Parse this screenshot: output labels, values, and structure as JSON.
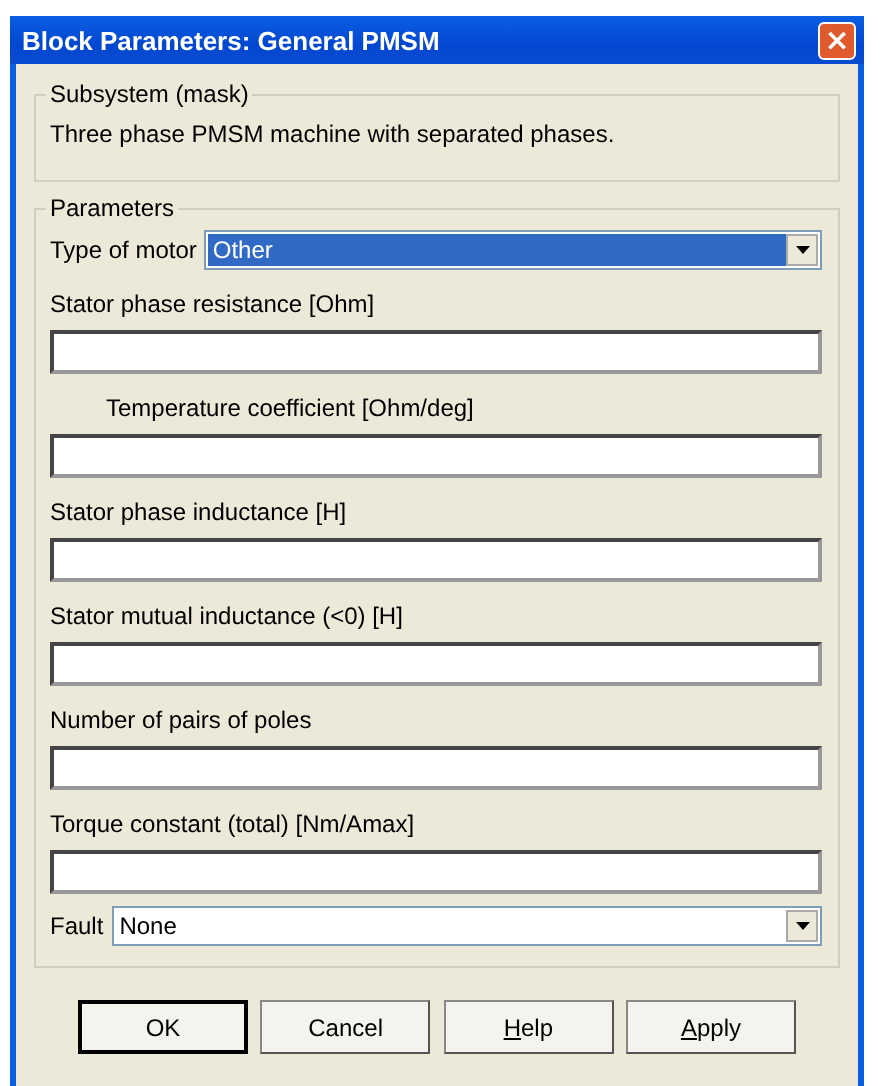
{
  "window": {
    "title": "Block Parameters: General PMSM",
    "close_glyph": "×"
  },
  "subsystem": {
    "legend": "Subsystem (mask)",
    "description": "Three phase PMSM machine with separated phases."
  },
  "parameters": {
    "legend": "Parameters",
    "motor_type": {
      "label": "Type of motor",
      "value": "Other",
      "focused": true
    },
    "fields": [
      {
        "label": "Stator phase resistance [Ohm]",
        "indented": false
      },
      {
        "label": "Temperature coefficient [Ohm/deg]",
        "indented": true
      },
      {
        "label": "Stator phase inductance [H]",
        "indented": false
      },
      {
        "label": "Stator mutual inductance (<0) [H]",
        "indented": false
      },
      {
        "label": "Number of pairs of poles",
        "indented": false
      },
      {
        "label": "Torque constant (total) [Nm/Amax]",
        "indented": false
      }
    ],
    "fault": {
      "label": "Fault",
      "value": "None",
      "focused": false
    }
  },
  "buttons": [
    {
      "label": "OK",
      "default": true,
      "underline_first": false
    },
    {
      "label": "Cancel",
      "default": false,
      "underline_first": false
    },
    {
      "label": "Help",
      "default": false,
      "underline_first": true
    },
    {
      "label": "Apply",
      "default": false,
      "underline_first": true
    }
  ]
}
